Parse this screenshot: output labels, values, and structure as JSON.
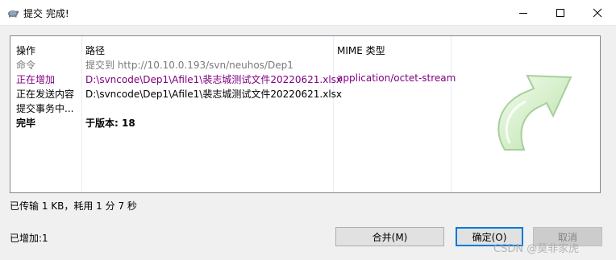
{
  "window": {
    "title": "提交 完成!",
    "icon": "tortoise-icon"
  },
  "columns": {
    "action": "操作",
    "path": "路径",
    "mime": "MIME 类型"
  },
  "rows": [
    {
      "action": "命令",
      "path": "提交到 http://10.10.0.193/svn/neuhos/Dep1",
      "mime": "",
      "color": "#7a7a7a"
    },
    {
      "action": "正在增加",
      "path": "D:\\svncode\\Dep1\\Afile1\\裴志城测试文件20220621.xlsx",
      "mime": "application/octet-stream",
      "color": "#800080"
    },
    {
      "action": "正在发送内容",
      "path": "D:\\svncode\\Dep1\\Afile1\\裴志城测试文件20220621.xlsx",
      "mime": "",
      "color": "#000000"
    },
    {
      "action": "提交事务中...",
      "path": "",
      "mime": "",
      "color": "#000000"
    },
    {
      "action": "完毕",
      "path": "于版本: 18",
      "mime": "",
      "color": "#000000"
    }
  ],
  "status": {
    "transfer": "已传输 1 KB，耗用 1 分 7 秒",
    "added": "已增加:1"
  },
  "buttons": {
    "merge": "合并(M)",
    "ok": "确定(O)",
    "cancel": "取消"
  },
  "watermark": "CSDN @莫非家虎"
}
